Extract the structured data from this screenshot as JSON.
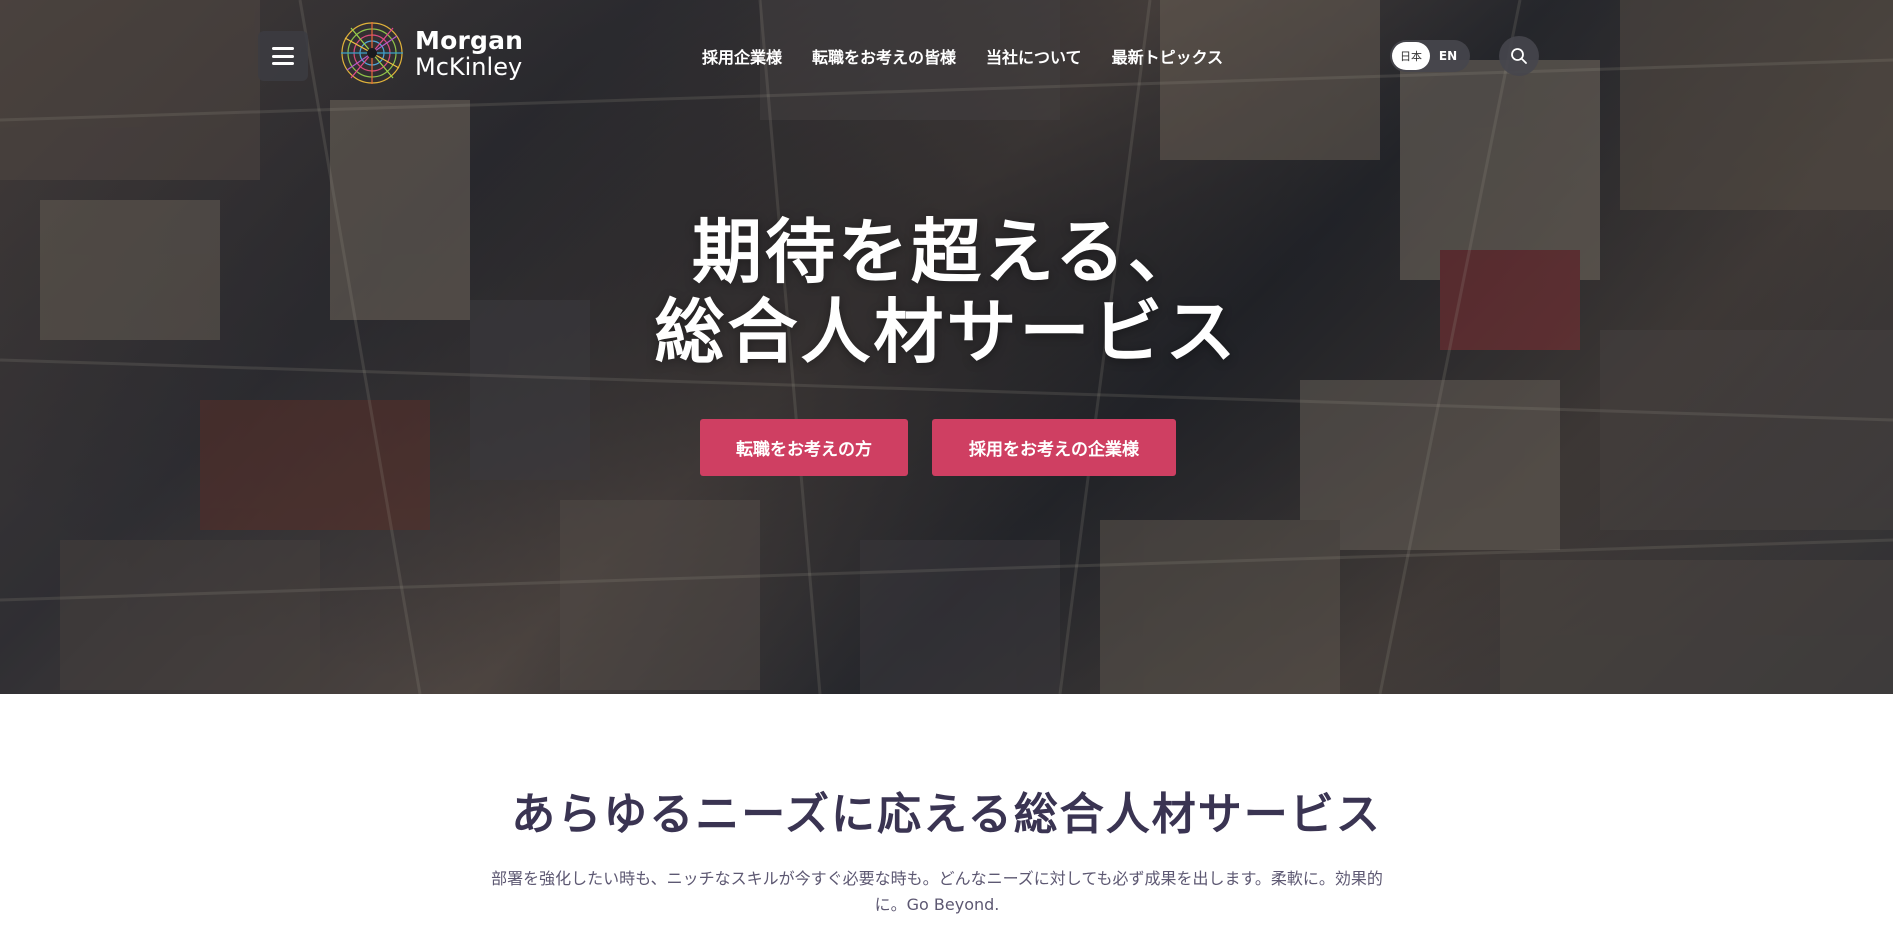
{
  "header": {
    "menu_icon": "hamburger-menu-icon",
    "logo": {
      "line1": "Morgan",
      "line2": "McKinley"
    },
    "nav": [
      {
        "label": "採用企業様"
      },
      {
        "label": "転職をお考えの皆様"
      },
      {
        "label": "当社について"
      },
      {
        "label": "最新トピックス"
      }
    ],
    "lang": {
      "ja": "日本",
      "en": "EN"
    },
    "search_icon": "search-icon"
  },
  "hero": {
    "title_line1": "期待を超える、",
    "title_line2": "総合人材サービス",
    "cta_seekers": "転職をお考えの方",
    "cta_employers": "採用をお考えの企業様"
  },
  "intro": {
    "title": "あらゆるニーズに応える総合人材サービス",
    "description": "部署を強化したい時も、ニッチなスキルが今すぐ必要な時も。どんなニーズに対しても必ず成果を出します。柔軟に。効果的に。Go Beyond."
  },
  "colors": {
    "accent": "#cf3f62",
    "heading": "#3a3452",
    "body_text": "#5d5872"
  }
}
